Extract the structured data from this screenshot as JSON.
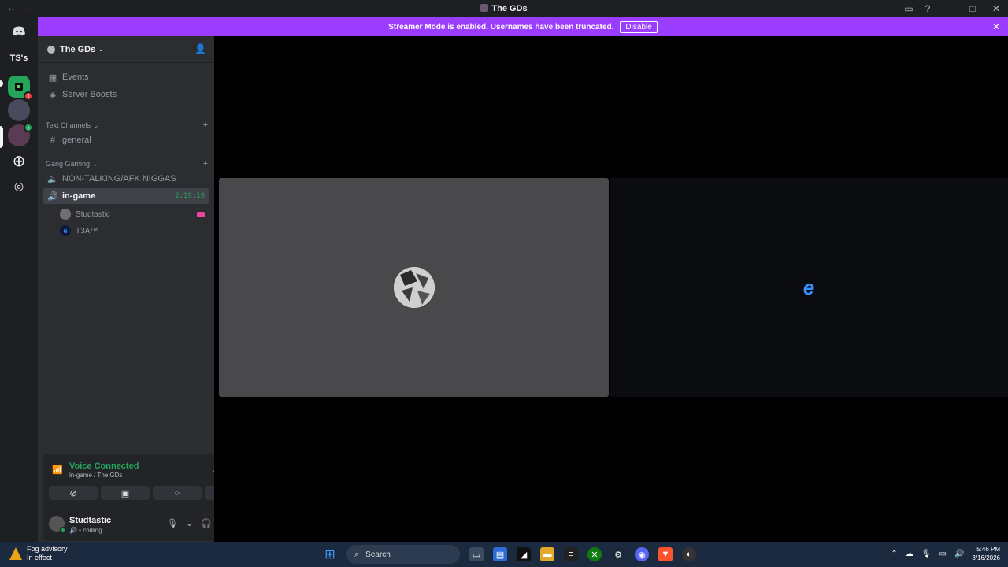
{
  "window": {
    "title": "The GDs",
    "back": "←",
    "forward": "→",
    "inbox_icon": "inbox-icon",
    "help": "?",
    "minimize": "─",
    "maximize": "□",
    "close": "✕"
  },
  "banner": {
    "text": "Streamer Mode is enabled. Usernames have been truncated.",
    "disable_label": "Disable",
    "close": "✕"
  },
  "servers": [
    {
      "label": "TS's"
    }
  ],
  "server_badge": "1",
  "server": {
    "name": "The GDs",
    "chevron": "⌄",
    "invite_icon": "add-member-icon"
  },
  "nav": {
    "events": "Events",
    "boosts": "Server Boosts"
  },
  "categories": {
    "text": "Text Channels",
    "gang": "Gang Gaming",
    "chevron": "⌄",
    "plus": "+"
  },
  "channels": {
    "general": "general",
    "afk": "NON-TALKING/AFK NIGGAS",
    "ingame": "in-game",
    "timer": "2:19:19"
  },
  "voice_users": [
    {
      "name": "Studtastic"
    },
    {
      "name": "T3A™"
    }
  ],
  "voice": {
    "status": "Voice Connected",
    "location": "in-game / The GDs"
  },
  "user": {
    "name": "Studtastic",
    "status": "chilling"
  },
  "taskbar": {
    "weather_line1": "Fog advisory",
    "weather_line2": "In effect",
    "search_label": "Search",
    "time": "5:46 PM",
    "date": "3/16/2026"
  }
}
